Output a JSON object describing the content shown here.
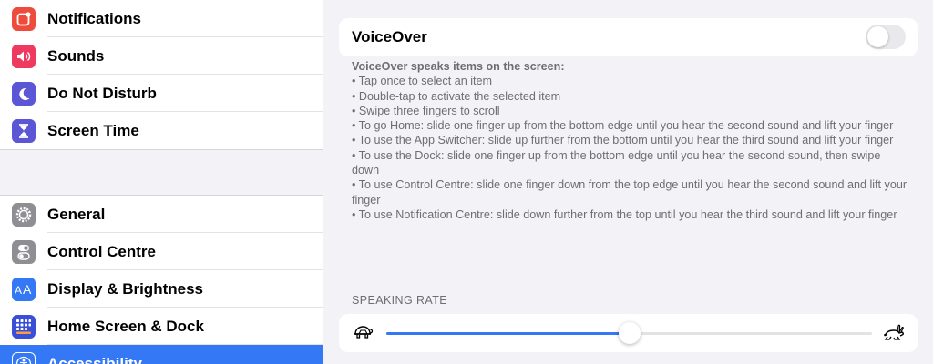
{
  "sidebar": {
    "items": [
      {
        "label": "Notifications",
        "icon": "notifications-icon",
        "color": "#ee4b3c"
      },
      {
        "label": "Sounds",
        "icon": "speaker-icon",
        "color": "#ee3a5e"
      },
      {
        "label": "Do Not Disturb",
        "icon": "moon-icon",
        "color": "#5a56d6"
      },
      {
        "label": "Screen Time",
        "icon": "hourglass-icon",
        "color": "#5a56d6"
      },
      {
        "label": "General",
        "icon": "gear-icon",
        "color": "#8e8e93"
      },
      {
        "label": "Control Centre",
        "icon": "switches-icon",
        "color": "#8e8e93"
      },
      {
        "label": "Display & Brightness",
        "icon": "text-size-icon",
        "color": "#3478f6"
      },
      {
        "label": "Home Screen & Dock",
        "icon": "app-grid-icon",
        "color": "#3a4fd8"
      },
      {
        "label": "Accessibility",
        "icon": "accessibility-icon",
        "color": "#3478f6",
        "selected": true
      }
    ]
  },
  "voiceover": {
    "title": "VoiceOver",
    "enabled": false,
    "intro": "VoiceOver speaks items on the screen:",
    "items": [
      "•  Tap once to select an item",
      "•  Double-tap to activate the selected item",
      "•  Swipe three fingers to scroll",
      "•  To go Home: slide one finger up from the bottom edge until you hear the second sound and lift your finger",
      "•  To use the App Switcher: slide up further from the bottom until you hear the third sound and lift your finger",
      "•  To use the Dock: slide one finger up from the bottom edge until you hear the second sound, then swipe down",
      "•  To use Control Centre: slide one finger down from the top edge until you hear the second sound and lift your finger",
      "•  To use Notification Centre: slide down further from the top until you hear the third sound and lift your finger"
    ]
  },
  "speaking_rate": {
    "header": "SPEAKING RATE",
    "value_fraction": 0.5,
    "min_icon": "tortoise-icon",
    "max_icon": "hare-icon"
  },
  "colors": {
    "accent": "#3478f6",
    "background": "#f2f2f7",
    "secondary_text": "#6d6d72"
  }
}
